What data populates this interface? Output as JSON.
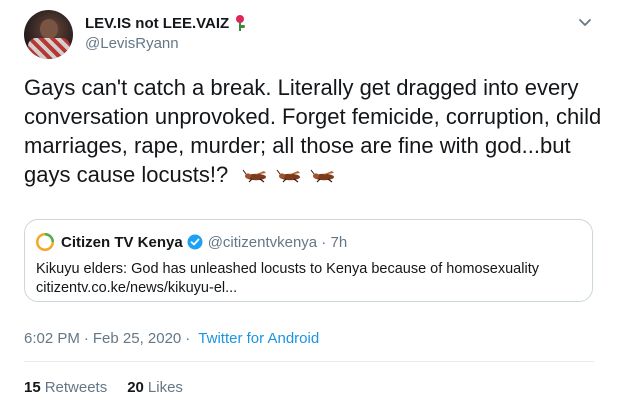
{
  "author": {
    "display_name": "LEV.IS not LEE.VAIZ",
    "handle": "@LevisRyann",
    "name_emoji_icon": "rose-icon"
  },
  "tweet": {
    "text": "Gays can't catch a break. Literally get dragged into every conversation unprovoked. Forget femicide, corruption, child marriages, rape, murder; all those are fine with god...but gays cause locusts!?",
    "trailing_emoji_icon": "locust-icon",
    "trailing_emoji_count": 3
  },
  "quoted_tweet": {
    "display_name": "Citizen TV Kenya",
    "verified": true,
    "handle_time": "@citizentvkenya · 7h",
    "text": "Kikuyu elders: God has unleashed locusts to Kenya because of homosexuality",
    "link": "citizentv.co.ke/news/kikuyu-el..."
  },
  "meta": {
    "time": "6:02 PM",
    "date": "Feb 25, 2020",
    "separator": "·",
    "client": "Twitter for Android"
  },
  "stats": {
    "retweets_count": "15",
    "retweets_label": "Retweets",
    "likes_count": "20",
    "likes_label": "Likes"
  },
  "colors": {
    "link_blue": "#1b95e0",
    "secondary_text": "#657786",
    "verified_blue": "#1da1f2",
    "citizen_orange": "#f5a623",
    "citizen_green": "#4caf50"
  }
}
